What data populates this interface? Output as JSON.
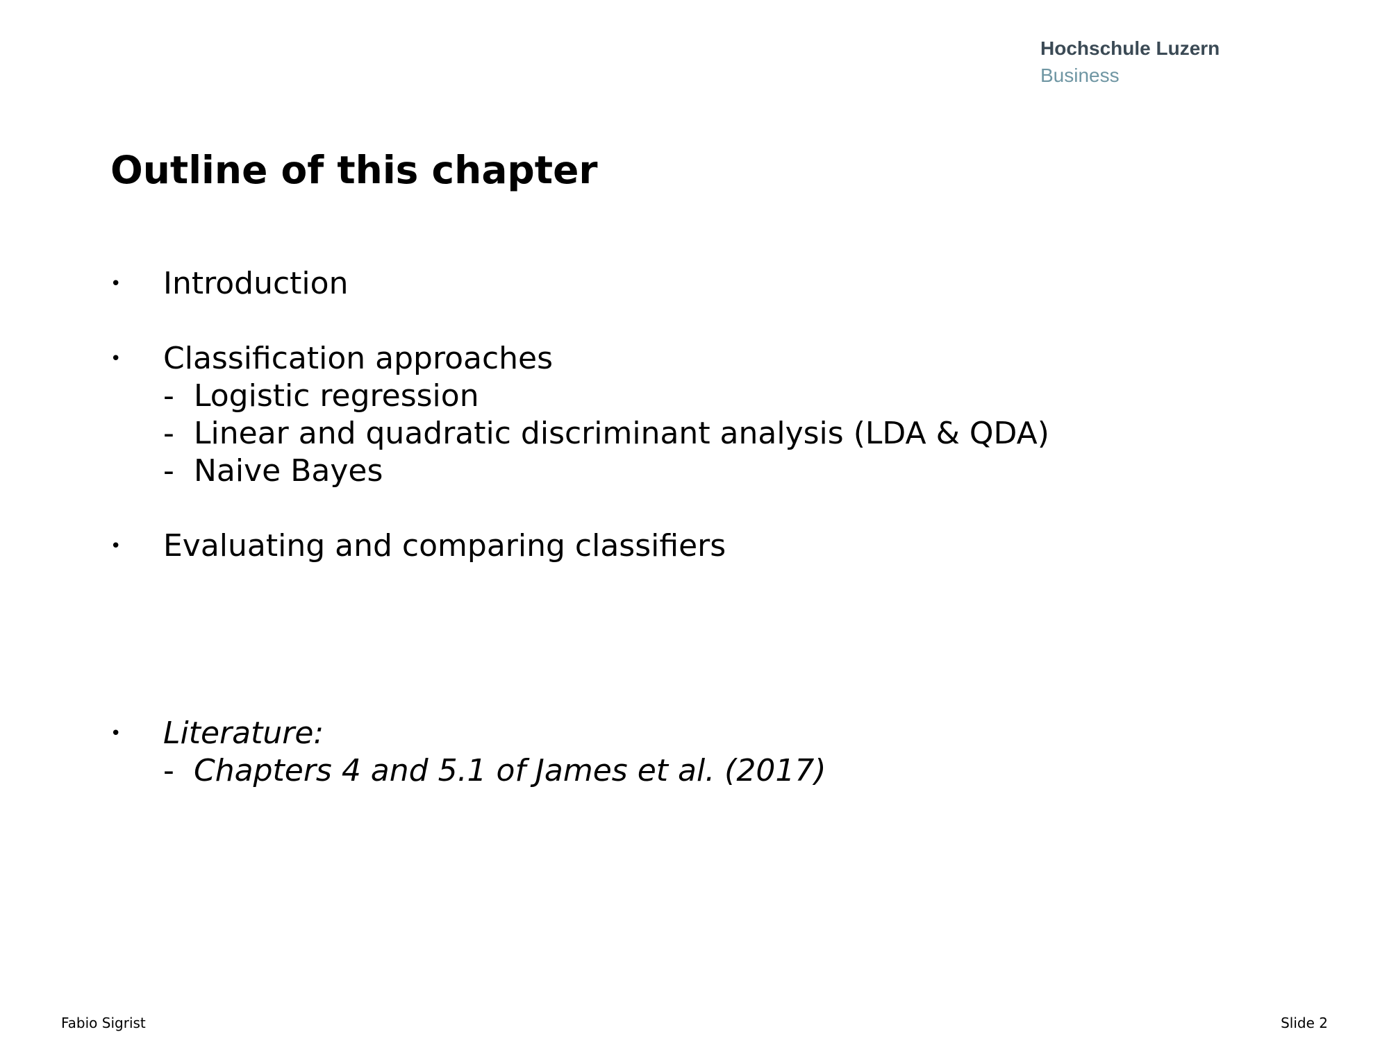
{
  "logo": {
    "line1": "Hochschule Luzern",
    "line2": "Business"
  },
  "title": "Outline of this chapter",
  "bullet_glyph": "•",
  "dash_glyph": "-",
  "outline": {
    "intro": "Introduction",
    "classification": "Classification approaches",
    "sub_items": [
      "Logistic regression",
      "Linear and quadratic discriminant analysis (LDA & QDA)",
      "Naive Bayes"
    ],
    "evaluating": "Evaluating and comparing classifiers",
    "literature": "Literature:",
    "literature_sub": "Chapters 4 and 5.1 of James et al. (2017)"
  },
  "footer": {
    "author": "Fabio Sigrist",
    "slide": "Slide 2"
  }
}
